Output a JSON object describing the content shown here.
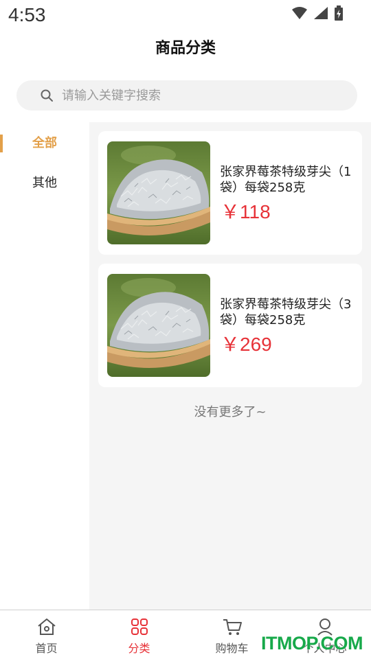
{
  "status_bar": {
    "time": "4:53",
    "icons": [
      "wifi-icon",
      "signal-icon",
      "battery-charging-icon"
    ]
  },
  "header": {
    "title": "商品分类"
  },
  "search": {
    "placeholder": "请输入关键字搜索",
    "value": ""
  },
  "sidebar": {
    "items": [
      {
        "label": "全部",
        "active": true
      },
      {
        "label": "其他",
        "active": false
      }
    ]
  },
  "products": [
    {
      "name": "张家界莓茶特级芽尖（1袋）每袋258克",
      "price": "￥118",
      "image": "vine-tea-photo"
    },
    {
      "name": "张家界莓茶特级芽尖（3袋）每袋258克",
      "price": "￥269",
      "image": "vine-tea-photo"
    }
  ],
  "list_end_text": "没有更多了~",
  "tab_bar": {
    "tabs": [
      {
        "label": "首页",
        "icon": "home-icon",
        "active": false
      },
      {
        "label": "分类",
        "icon": "category-grid-icon",
        "active": true
      },
      {
        "label": "购物车",
        "icon": "cart-icon",
        "active": false
      },
      {
        "label": "个人中心",
        "icon": "user-icon",
        "active": false
      }
    ]
  },
  "watermark": "ITMOP.COM",
  "colors": {
    "accent_orange": "#e3a04a",
    "price_red": "#e73238",
    "active_tab_red": "#e73238",
    "watermark_green": "#17a94a"
  }
}
